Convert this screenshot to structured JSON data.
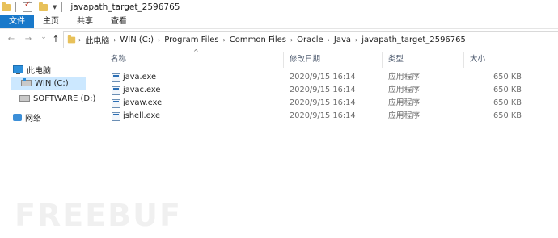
{
  "window": {
    "title": "javapath_target_2596765"
  },
  "quick_access": {
    "icons": [
      "folder-icon",
      "properties-checkbox-icon",
      "folder-icon",
      "dropdown-arrow-icon"
    ]
  },
  "ribbon": {
    "tabs": [
      {
        "label": "文件",
        "active": true
      },
      {
        "label": "主页"
      },
      {
        "label": "共享"
      },
      {
        "label": "查看"
      }
    ]
  },
  "nav": {
    "back": "←",
    "forward": "→",
    "recent": "⌄",
    "up": "↑"
  },
  "breadcrumb": [
    "此电脑",
    "WIN (C:)",
    "Program Files",
    "Common Files",
    "Oracle",
    "Java",
    "javapath_target_2596765"
  ],
  "sidebar": {
    "items": [
      {
        "label": "此电脑",
        "icon": "computer-icon"
      },
      {
        "label": "WIN (C:)",
        "icon": "windows-drive-icon",
        "selected": true
      },
      {
        "label": "SOFTWARE (D:)",
        "icon": "drive-icon"
      },
      {
        "label": "网络",
        "icon": "network-icon"
      }
    ]
  },
  "columns": {
    "name": "名称",
    "modified": "修改日期",
    "type": "类型",
    "size": "大小"
  },
  "files": [
    {
      "name": "java.exe",
      "modified": "2020/9/15 16:14",
      "type": "应用程序",
      "size": "650 KB"
    },
    {
      "name": "javac.exe",
      "modified": "2020/9/15 16:14",
      "type": "应用程序",
      "size": "650 KB"
    },
    {
      "name": "javaw.exe",
      "modified": "2020/9/15 16:14",
      "type": "应用程序",
      "size": "650 KB"
    },
    {
      "name": "jshell.exe",
      "modified": "2020/9/15 16:14",
      "type": "应用程序",
      "size": "650 KB"
    }
  ],
  "watermark": "FREEBUF",
  "colors": {
    "accent": "#1979ca",
    "selection": "#cce8ff"
  }
}
